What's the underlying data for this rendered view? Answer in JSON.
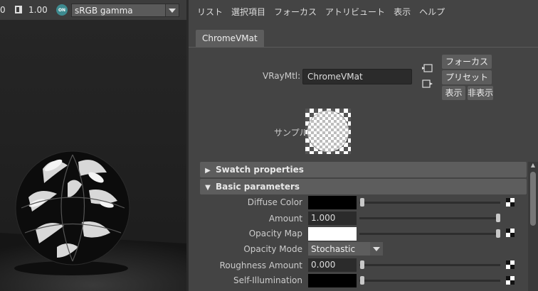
{
  "viewport_toolbar": {
    "exposure_value": "0",
    "gamma_value": "1.00",
    "color_mgmt_badge": "ON",
    "color_space": "sRGB gamma"
  },
  "menu": [
    "リスト",
    "選択項目",
    "フォーカス",
    "アトリビュート",
    "表示",
    "ヘルプ"
  ],
  "tab": {
    "label": "ChromeVMat"
  },
  "material": {
    "type_label": "VRayMtl:",
    "name_value": "ChromeVMat",
    "focus_button": "フォーカス",
    "preset_button": "プリセット",
    "show_button": "表示",
    "hide_button": "非表示",
    "sample_label": "サンプル"
  },
  "sections": {
    "swatch": "Swatch properties",
    "basic": "Basic parameters"
  },
  "attributes": {
    "diffuse_color": {
      "label": "Diffuse Color",
      "color": "#000000"
    },
    "amount": {
      "label": "Amount",
      "value": "1.000"
    },
    "opacity_map": {
      "label": "Opacity Map",
      "color": "#ffffff"
    },
    "opacity_mode": {
      "label": "Opacity Mode",
      "value": "Stochastic"
    },
    "roughness": {
      "label": "Roughness Amount",
      "value": "0.000"
    },
    "self_illum": {
      "label": "Self-Illumination",
      "color": "#000000"
    }
  },
  "colors": {
    "panel_bg": "#444444",
    "header_bg": "#5d5d5d",
    "field_bg": "#2b2b2b"
  }
}
